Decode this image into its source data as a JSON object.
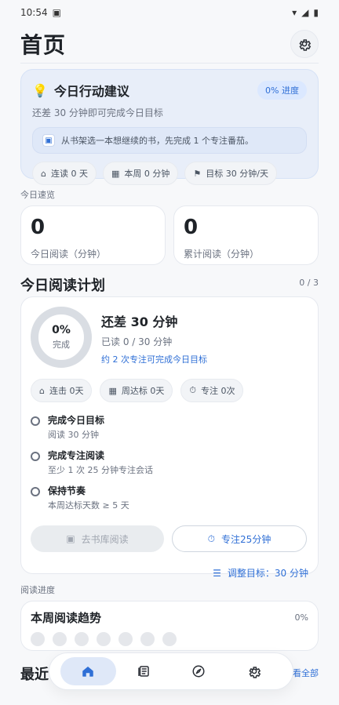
{
  "status": {
    "time": "10:54"
  },
  "header": {
    "title": "首页"
  },
  "action_card": {
    "title": "今日行动建议",
    "badge": "0% 进度",
    "subtitle": "还差 30 分钟即可完成今日目标",
    "hint": "从书架选一本想继续的书，先完成 1 个专注番茄。",
    "chips": [
      "连读 0 天",
      "本周 0 分钟",
      "目标 30 分钟/天"
    ]
  },
  "overview": {
    "label": "今日速览",
    "today_value": "0",
    "today_label": "今日阅读（分钟）",
    "total_value": "0",
    "total_label": "累计阅读（分钟）"
  },
  "plan": {
    "title": "今日阅读计划",
    "count": "0 / 3",
    "progress_percent": "0%",
    "progress_label": "完成",
    "remaining": "还差 30 分钟",
    "read": "已读 0 / 30 分钟",
    "focus_tip": "约 2 次专注可完成今日目标",
    "chips": [
      "连击 0天",
      "周达标 0天",
      "专注 0次"
    ],
    "tasks": [
      {
        "title": "完成今日目标",
        "desc": "阅读 30 分钟"
      },
      {
        "title": "完成专注阅读",
        "desc": "至少 1 次 25 分钟专注会话"
      },
      {
        "title": "保持节奏",
        "desc": "本周达标天数 ≥ 5 天"
      }
    ],
    "btn_library": "去书库阅读",
    "btn_focus": "专注25分钟",
    "adjust": "调整目标：30 分钟"
  },
  "progress": {
    "label": "阅读进度",
    "title": "本周阅读趋势",
    "percent": "0%"
  },
  "recent": {
    "title": "最近",
    "view_all": "看全部"
  },
  "nav": {
    "items": [
      "home",
      "library",
      "discover",
      "settings"
    ]
  }
}
